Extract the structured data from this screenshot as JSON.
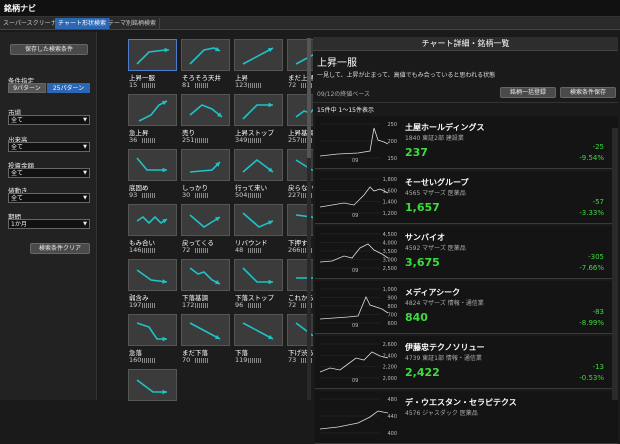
{
  "app": {
    "title": "銘柄ナビ"
  },
  "tabs": [
    "スーパースクリーナー",
    "チャート形状検索",
    "テーマ別銘柄検索"
  ],
  "sidebar": {
    "save_button": "保存した検索条件",
    "condition_label": "条件指定",
    "pattern9": "9パターン",
    "pattern25": "25パターン",
    "market_label": "市場",
    "market_value": "全て",
    "volume_label": "出来高",
    "volume_value": "全て",
    "invest_label": "投資金額",
    "invest_value": "全て",
    "price_move_label": "値動き",
    "price_move_value": "全て",
    "period_label": "期間",
    "period_value": "1か月",
    "clear_button": "検索条件クリア"
  },
  "patterns": [
    {
      "name": "上昇一服",
      "count": "15",
      "shape": "up-flat"
    },
    {
      "name": "そろそろ天井",
      "count": "81",
      "shape": "up-top"
    },
    {
      "name": "上昇",
      "count": "123",
      "shape": "up"
    },
    {
      "name": "まだ上昇",
      "count": "72",
      "shape": "up"
    },
    {
      "name": "急上昇",
      "count": "36",
      "shape": "steep-up"
    },
    {
      "name": "売り",
      "count": "251",
      "shape": "up-dip"
    },
    {
      "name": "上昇ストップ",
      "count": "349",
      "shape": "up-stop"
    },
    {
      "name": "上昇基調",
      "count": "257",
      "shape": "up-zig"
    },
    {
      "name": "底固め",
      "count": "93",
      "shape": "bottom"
    },
    {
      "name": "しっかり",
      "count": "30",
      "shape": "flat-up"
    },
    {
      "name": "行って来い",
      "count": "504",
      "shape": "peak"
    },
    {
      "name": "戻らない",
      "count": "227",
      "shape": "down-flat"
    },
    {
      "name": "もみ合い",
      "count": "146",
      "shape": "zigzag"
    },
    {
      "name": "戻ってくる",
      "count": "72",
      "shape": "valley"
    },
    {
      "name": "リバウンド",
      "count": "48",
      "shape": "rebound"
    },
    {
      "name": "下押す",
      "count": "266",
      "shape": "down-end"
    },
    {
      "name": "弱含み",
      "count": "197",
      "shape": "down-soft"
    },
    {
      "name": "下落基調",
      "count": "172",
      "shape": "down-zig"
    },
    {
      "name": "下落ストップ",
      "count": "96",
      "shape": "down-stop"
    },
    {
      "name": "これから上昇",
      "count": "72",
      "shape": "flat-rise"
    },
    {
      "name": "急落",
      "count": "160",
      "shape": "crash"
    },
    {
      "name": "まだ下落",
      "count": "70",
      "shape": "down"
    },
    {
      "name": "下落",
      "count": "119",
      "shape": "down"
    },
    {
      "name": "下げ渋る",
      "count": "73",
      "shape": "down-slow"
    },
    {
      "name": "",
      "count": "",
      "shape": "down-flat2"
    }
  ],
  "detail": {
    "header": "チャート詳細・銘柄一覧",
    "title": "上昇一服",
    "description": "一見して、上昇が止まって、高値でもみ合っていると思われる状態",
    "bulk_register": "銘柄一括登録",
    "save_condition": "検索条件保存",
    "base_date": "09/12の終値ベース",
    "result_count": "15件中 1〜15件表示"
  },
  "stocks": [
    {
      "name": "土屋ホールディングス",
      "code": "1840",
      "market": "東証2部",
      "sector": "建設業",
      "price": "237",
      "change": "-25",
      "pct": "-9.54%",
      "yticks": [
        "250",
        "200",
        "150"
      ],
      "xtick": "09"
    },
    {
      "name": "そーせいグループ",
      "code": "4565",
      "market": "マザーズ",
      "sector": "医薬品",
      "price": "1,657",
      "change": "-57",
      "pct": "-3.33%",
      "yticks": [
        "1,800",
        "1,600",
        "1,400",
        "1,200"
      ],
      "xtick": "09"
    },
    {
      "name": "サンバイオ",
      "code": "4592",
      "market": "マザーズ",
      "sector": "医薬品",
      "price": "3,675",
      "change": "-305",
      "pct": "-7.66%",
      "yticks": [
        "4,500",
        "4,000",
        "3,500",
        "3,000",
        "2,500"
      ],
      "xtick": "09"
    },
    {
      "name": "メディアシーク",
      "code": "4824",
      "market": "マザーズ",
      "sector": "情報・通信業",
      "price": "840",
      "change": "-83",
      "pct": "-8.99%",
      "yticks": [
        "1,000",
        "900",
        "800",
        "700",
        "600"
      ],
      "xtick": "09"
    },
    {
      "name": "伊藤忠テクノソリュー",
      "code": "4739",
      "market": "東証1部",
      "sector": "情報・通信業",
      "price": "2,422",
      "change": "-13",
      "pct": "-0.53%",
      "yticks": [
        "2,600",
        "2,400",
        "2,200",
        "2,000"
      ],
      "xtick": "09"
    },
    {
      "name": "デ・ウエスタン・セラピテクス",
      "code": "4576",
      "market": "ジャスダック",
      "sector": "医薬品",
      "price": "",
      "change": "",
      "pct": "",
      "yticks": [
        "480",
        "440",
        "400"
      ],
      "xtick": ""
    }
  ],
  "colors": {
    "accent": "#2b67b4",
    "up_arrow": "#1ec3c8",
    "positive_text": "#3ddc3d"
  }
}
